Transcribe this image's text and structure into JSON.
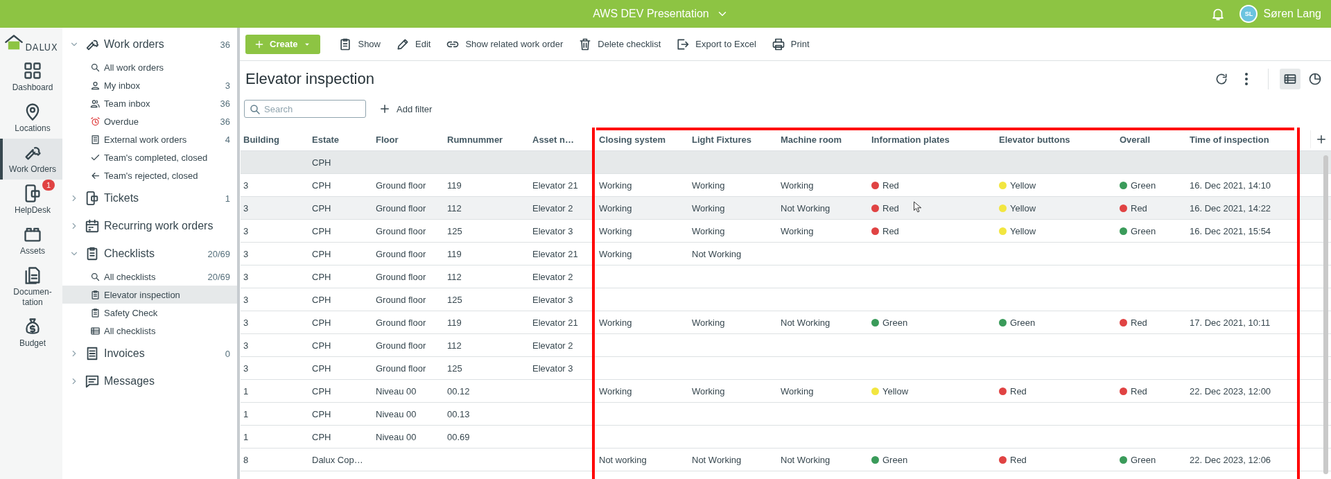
{
  "top_bar": {
    "project": "AWS DEV Presentation",
    "user": {
      "initials": "SL",
      "name": "Søren Lang"
    }
  },
  "logo": {
    "text": "DALUX"
  },
  "rail": [
    {
      "label": "Dashboard",
      "selected": false
    },
    {
      "label": "Locations",
      "selected": false
    },
    {
      "label": "Work Orders",
      "selected": true
    },
    {
      "label": "HelpDesk",
      "selected": false,
      "badge": "1"
    },
    {
      "label": "Assets",
      "selected": false
    },
    {
      "label": "Documen-tation",
      "selected": false
    },
    {
      "label": "Budget",
      "selected": false
    }
  ],
  "nav": [
    {
      "label": "Work orders",
      "count": "36",
      "expanded": true,
      "children": [
        {
          "label": "All work orders",
          "selected": false
        },
        {
          "label": "My inbox",
          "count": "3",
          "selected": false
        },
        {
          "label": "Team inbox",
          "count": "36",
          "selected": false
        },
        {
          "label": "Overdue",
          "count": "36",
          "selected": false
        },
        {
          "label": "External work orders",
          "count": "4",
          "selected": false
        },
        {
          "label": "Team's completed, closed",
          "selected": false
        },
        {
          "label": "Team's rejected, closed",
          "selected": false
        }
      ]
    },
    {
      "label": "Tickets",
      "count": "1",
      "expanded": false
    },
    {
      "label": "Recurring work orders",
      "expanded": false
    },
    {
      "label": "Checklists",
      "count": "20/69",
      "expanded": true,
      "children": [
        {
          "label": "All checklists",
          "count": "20/69",
          "selected": false
        },
        {
          "label": "Elevator inspection",
          "selected": true
        },
        {
          "label": "Safety Check",
          "selected": false
        },
        {
          "label": "All checklists",
          "selected": false
        }
      ]
    },
    {
      "label": "Invoices",
      "count": "0",
      "expanded": false
    },
    {
      "label": "Messages",
      "expanded": false
    }
  ],
  "toolbar": [
    {
      "label": "Create",
      "kind": "primary"
    },
    {
      "label": "Show",
      "kind": "plain"
    },
    {
      "label": "Edit",
      "kind": "plain"
    },
    {
      "label": "Show related work order",
      "kind": "plain"
    },
    {
      "label": "Delete checklist",
      "kind": "plain"
    },
    {
      "label": "Export to Excel",
      "kind": "plain"
    },
    {
      "label": "Print",
      "kind": "plain"
    }
  ],
  "page_title": "Elevator inspection",
  "views": [
    {
      "selected": true
    },
    {
      "selected": false
    }
  ],
  "search": {
    "placeholder": "Search"
  },
  "add_filter": "Add filter",
  "table": {
    "columns": [
      {
        "label": "Building",
        "highlighted": false
      },
      {
        "label": "Estate",
        "highlighted": false
      },
      {
        "label": "Floor",
        "highlighted": false
      },
      {
        "label": "Rumnummer",
        "highlighted": false
      },
      {
        "label": "Asset n…",
        "highlighted": false
      },
      {
        "label": "Closing system",
        "highlighted": true
      },
      {
        "label": "Light Fixtures",
        "highlighted": true
      },
      {
        "label": "Machine room",
        "highlighted": true
      },
      {
        "label": "Information plates",
        "highlighted": true
      },
      {
        "label": "Elevator buttons",
        "highlighted": true
      },
      {
        "label": "Overall",
        "highlighted": true
      },
      {
        "label": "Time of inspection",
        "highlighted": true
      }
    ],
    "rows": [
      {
        "kind": "group",
        "hovered": false,
        "cells": [
          null,
          "CPH",
          null,
          null,
          null,
          null,
          null,
          null,
          null,
          null,
          null,
          null
        ]
      },
      {
        "kind": "item",
        "hovered": false,
        "cells": [
          "3",
          "CPH",
          "Ground floor",
          "119",
          "Elevator 21",
          "Working",
          "Working",
          "Working",
          {
            "text": "Red",
            "color": "#e04343"
          },
          {
            "text": "Yellow",
            "color": "#f2e640"
          },
          {
            "text": "Green",
            "color": "#3a9b5a"
          },
          "16. Dec 2021, 14:10"
        ]
      },
      {
        "kind": "item",
        "hovered": true,
        "cells": [
          "3",
          "CPH",
          "Ground floor",
          "112",
          "Elevator 2",
          "Working",
          "Working",
          "Not Working",
          {
            "text": "Red",
            "color": "#e04343"
          },
          {
            "text": "Yellow",
            "color": "#f2e640"
          },
          {
            "text": "Red",
            "color": "#e04343"
          },
          "16. Dec 2021, 14:22"
        ]
      },
      {
        "kind": "item",
        "hovered": false,
        "cells": [
          "3",
          "CPH",
          "Ground floor",
          "125",
          "Elevator 3",
          "Working",
          "Working",
          "Working",
          {
            "text": "Red",
            "color": "#e04343"
          },
          {
            "text": "Yellow",
            "color": "#f2e640"
          },
          {
            "text": "Green",
            "color": "#3a9b5a"
          },
          "16. Dec 2021, 15:54"
        ]
      },
      {
        "kind": "item",
        "hovered": false,
        "cells": [
          "3",
          "CPH",
          "Ground floor",
          "119",
          "Elevator 21",
          "Working",
          "Not Working",
          null,
          null,
          null,
          null,
          null
        ]
      },
      {
        "kind": "item",
        "hovered": false,
        "cells": [
          "3",
          "CPH",
          "Ground floor",
          "112",
          "Elevator 2",
          null,
          null,
          null,
          null,
          null,
          null,
          null
        ]
      },
      {
        "kind": "item",
        "hovered": false,
        "cells": [
          "3",
          "CPH",
          "Ground floor",
          "125",
          "Elevator 3",
          null,
          null,
          null,
          null,
          null,
          null,
          null
        ]
      },
      {
        "kind": "item",
        "hovered": false,
        "cells": [
          "3",
          "CPH",
          "Ground floor",
          "119",
          "Elevator 21",
          "Working",
          "Working",
          "Not Working",
          {
            "text": "Green",
            "color": "#3a9b5a"
          },
          {
            "text": "Green",
            "color": "#3a9b5a"
          },
          {
            "text": "Red",
            "color": "#e04343"
          },
          "17. Dec 2021, 10:11"
        ]
      },
      {
        "kind": "item",
        "hovered": false,
        "cells": [
          "3",
          "CPH",
          "Ground floor",
          "112",
          "Elevator 2",
          null,
          null,
          null,
          null,
          null,
          null,
          null
        ]
      },
      {
        "kind": "item",
        "hovered": false,
        "cells": [
          "3",
          "CPH",
          "Ground floor",
          "125",
          "Elevator 3",
          null,
          null,
          null,
          null,
          null,
          null,
          null
        ]
      },
      {
        "kind": "item",
        "hovered": false,
        "cells": [
          "1",
          "CPH",
          "Niveau 00",
          "00.12",
          null,
          "Working",
          "Working",
          "Working",
          {
            "text": "Yellow",
            "color": "#f2e640"
          },
          {
            "text": "Red",
            "color": "#e04343"
          },
          {
            "text": "Red",
            "color": "#e04343"
          },
          "22. Dec 2023, 12:00"
        ]
      },
      {
        "kind": "item",
        "hovered": false,
        "cells": [
          "1",
          "CPH",
          "Niveau 00",
          "00.13",
          null,
          null,
          null,
          null,
          null,
          null,
          null,
          null
        ]
      },
      {
        "kind": "item",
        "hovered": false,
        "cells": [
          "1",
          "CPH",
          "Niveau 00",
          "00.69",
          null,
          null,
          null,
          null,
          null,
          null,
          null,
          null
        ]
      },
      {
        "kind": "item",
        "hovered": false,
        "cells": [
          "8",
          "Dalux Cop…",
          null,
          null,
          null,
          "Not working",
          "Not Working",
          "Not Working",
          {
            "text": "Green",
            "color": "#3a9b5a"
          },
          {
            "text": "Red",
            "color": "#e04343"
          },
          {
            "text": "Green",
            "color": "#3a9b5a"
          },
          "22. Dec 2023, 12:06"
        ]
      }
    ]
  }
}
